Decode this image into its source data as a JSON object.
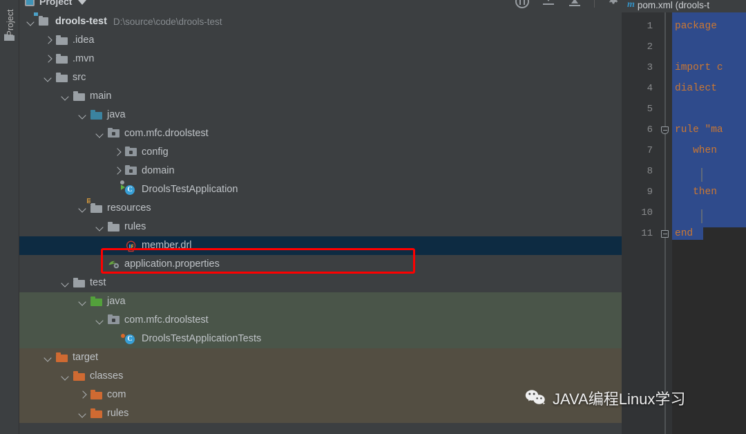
{
  "tool_strip": {
    "tab_label": "Project",
    "folder_icon": "folder-icon"
  },
  "panel_header": {
    "icon": "project-panel-icon",
    "title": "Project",
    "caret": "chevron-down-icon",
    "tools": [
      "bug-icon",
      "collapse-all-icon",
      "expand-all-icon",
      "gear-icon",
      "minimize-icon"
    ]
  },
  "tree": {
    "rows": [
      {
        "depth": 0,
        "arrow": "down",
        "icon": "module-icon",
        "label": "drools-test",
        "bold": true,
        "path": "D:\\source\\code\\drools-test",
        "bg": "none"
      },
      {
        "depth": 1,
        "arrow": "right",
        "icon": "folder-gray",
        "label": ".idea",
        "bg": "none"
      },
      {
        "depth": 1,
        "arrow": "right",
        "icon": "folder-gray",
        "label": ".mvn",
        "bg": "none"
      },
      {
        "depth": 1,
        "arrow": "down",
        "icon": "folder-gray",
        "label": "src",
        "bg": "none"
      },
      {
        "depth": 2,
        "arrow": "down",
        "icon": "folder-gray",
        "label": "main",
        "bg": "none"
      },
      {
        "depth": 3,
        "arrow": "down",
        "icon": "folder-blue",
        "label": "java",
        "bg": "none"
      },
      {
        "depth": 4,
        "arrow": "down",
        "icon": "package-icon",
        "label": "com.mfc.droolstest",
        "bg": "none"
      },
      {
        "depth": 5,
        "arrow": "right",
        "icon": "package-icon",
        "label": "config",
        "bg": "none"
      },
      {
        "depth": 5,
        "arrow": "right",
        "icon": "package-icon",
        "label": "domain",
        "bg": "none"
      },
      {
        "depth": 5,
        "arrow": "none",
        "icon": "spring-boot-class-icon",
        "label": "DroolsTestApplication",
        "bg": "none"
      },
      {
        "depth": 3,
        "arrow": "down",
        "icon": "resources-folder-icon",
        "label": "resources",
        "bg": "none"
      },
      {
        "depth": 4,
        "arrow": "down",
        "icon": "folder-gray",
        "label": "rules",
        "bg": "none"
      },
      {
        "depth": 5,
        "arrow": "none",
        "icon": "drl-file-icon",
        "label": "member.drl",
        "bg": "selected",
        "highlighted": true
      },
      {
        "depth": 4,
        "arrow": "none",
        "icon": "spring-properties-icon",
        "label": "application.properties",
        "bg": "none"
      },
      {
        "depth": 2,
        "arrow": "down",
        "icon": "folder-gray",
        "label": "test",
        "bg": "none"
      },
      {
        "depth": 3,
        "arrow": "down",
        "icon": "folder-green",
        "label": "java",
        "bg": "test"
      },
      {
        "depth": 4,
        "arrow": "down",
        "icon": "package-icon",
        "label": "com.mfc.droolstest",
        "bg": "test"
      },
      {
        "depth": 5,
        "arrow": "none",
        "icon": "test-class-icon",
        "label": "DroolsTestApplicationTests",
        "bg": "test"
      },
      {
        "depth": 1,
        "arrow": "down",
        "icon": "folder-orange",
        "label": "target",
        "bg": "target"
      },
      {
        "depth": 2,
        "arrow": "down",
        "icon": "folder-orange",
        "label": "classes",
        "bg": "target"
      },
      {
        "depth": 3,
        "arrow": "right",
        "icon": "folder-orange",
        "label": "com",
        "bg": "target"
      },
      {
        "depth": 3,
        "arrow": "down",
        "icon": "folder-orange",
        "label": "rules",
        "bg": "target"
      }
    ],
    "annotation": {
      "type": "red-rectangle",
      "color": "#fe0000",
      "target_row_label": "member.drl"
    }
  },
  "editor": {
    "tab_icon": "maven-icon",
    "tab_label": "pom.xml (drools-t",
    "line_numbers": [
      "1",
      "2",
      "3",
      "4",
      "5",
      "6",
      "7",
      "8",
      "9",
      "10",
      "11"
    ],
    "lines": [
      {
        "n": 1,
        "text": "package"
      },
      {
        "n": 2,
        "text": ""
      },
      {
        "n": 3,
        "text": "import c"
      },
      {
        "n": 4,
        "text": "dialect"
      },
      {
        "n": 5,
        "text": ""
      },
      {
        "n": 6,
        "text": "rule \"ma",
        "fold": true
      },
      {
        "n": 7,
        "text": "   when"
      },
      {
        "n": 8,
        "text": ""
      },
      {
        "n": 9,
        "text": "   then"
      },
      {
        "n": 10,
        "text": ""
      },
      {
        "n": 11,
        "text": "end",
        "fold": true
      }
    ],
    "selection_color": "#2f4b8c",
    "keyword_color": "#cc7832"
  },
  "watermark": {
    "icon": "wechat-icon",
    "text": "JAVA编程Linux学习"
  }
}
